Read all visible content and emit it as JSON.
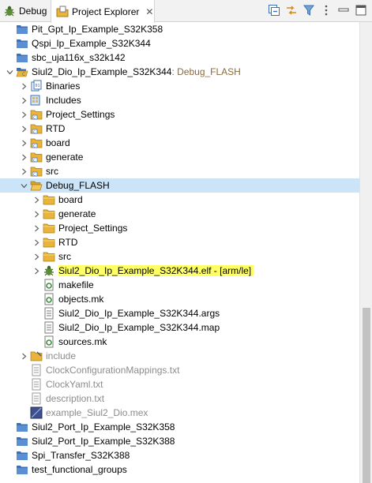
{
  "tabs": {
    "debug_label": "Debug",
    "explorer_label": "Project Explorer",
    "explorer_close": "✕"
  },
  "toolbar": {
    "icons": [
      "collapse-all-icon",
      "link-with-editor-icon",
      "filter-icon",
      "view-menu-icon",
      "minimize-icon",
      "maximize-icon"
    ]
  },
  "tree": {
    "rows": [
      {
        "label": "Pit_Gpt_Ip_Example_S32K358",
        "suffix": "",
        "icon": "project",
        "chev": "",
        "indent": 0
      },
      {
        "label": "Qspi_Ip_Example_S32K344",
        "suffix": "",
        "icon": "project",
        "chev": "",
        "indent": 0
      },
      {
        "label": "sbc_uja116x_s32k142",
        "suffix": "",
        "icon": "project",
        "chev": "",
        "indent": 0
      },
      {
        "label": "Siul2_Dio_Ip_Example_S32K344",
        "suffix": ": Debug_FLASH",
        "icon": "project-open",
        "chev": "expanded",
        "indent": 0
      },
      {
        "label": "Binaries",
        "suffix": "",
        "icon": "binaries",
        "chev": "collapsed",
        "indent": 1
      },
      {
        "label": "Includes",
        "suffix": "",
        "icon": "includes",
        "chev": "collapsed",
        "indent": 1
      },
      {
        "label": "Project_Settings",
        "suffix": "",
        "icon": "src-folder",
        "chev": "collapsed",
        "indent": 1
      },
      {
        "label": "RTD",
        "suffix": "",
        "icon": "src-folder",
        "chev": "collapsed",
        "indent": 1
      },
      {
        "label": "board",
        "suffix": "",
        "icon": "src-folder",
        "chev": "collapsed",
        "indent": 1
      },
      {
        "label": "generate",
        "suffix": "",
        "icon": "src-folder",
        "chev": "collapsed",
        "indent": 1
      },
      {
        "label": "src",
        "suffix": "",
        "icon": "src-folder",
        "chev": "collapsed",
        "indent": 1
      },
      {
        "label": "Debug_FLASH",
        "suffix": "",
        "icon": "folder-open",
        "chev": "expanded",
        "indent": 1,
        "selected": true
      },
      {
        "label": "board",
        "suffix": "",
        "icon": "folder",
        "chev": "collapsed",
        "indent": 2
      },
      {
        "label": "generate",
        "suffix": "",
        "icon": "folder",
        "chev": "collapsed",
        "indent": 2
      },
      {
        "label": "Project_Settings",
        "suffix": "",
        "icon": "folder",
        "chev": "collapsed",
        "indent": 2
      },
      {
        "label": "RTD",
        "suffix": "",
        "icon": "folder",
        "chev": "collapsed",
        "indent": 2
      },
      {
        "label": "src",
        "suffix": "",
        "icon": "folder",
        "chev": "collapsed",
        "indent": 2
      },
      {
        "label": "Siul2_Dio_Ip_Example_S32K344.elf - [arm/le]",
        "suffix": "",
        "icon": "elf",
        "chev": "collapsed",
        "indent": 2,
        "highlight": true
      },
      {
        "label": "makefile",
        "suffix": "",
        "icon": "makefile",
        "chev": "",
        "indent": 2
      },
      {
        "label": "objects.mk",
        "suffix": "",
        "icon": "mk-file",
        "chev": "",
        "indent": 2
      },
      {
        "label": "Siul2_Dio_Ip_Example_S32K344.args",
        "suffix": "",
        "icon": "text-file",
        "chev": "",
        "indent": 2
      },
      {
        "label": "Siul2_Dio_Ip_Example_S32K344.map",
        "suffix": "",
        "icon": "text-file",
        "chev": "",
        "indent": 2
      },
      {
        "label": "sources.mk",
        "suffix": "",
        "icon": "mk-file",
        "chev": "",
        "indent": 2
      },
      {
        "label": "include",
        "suffix": "",
        "icon": "folder-grey",
        "chev": "collapsed",
        "indent": 1,
        "grey": true
      },
      {
        "label": "ClockConfigurationMappings.txt",
        "suffix": "",
        "icon": "text-file-grey",
        "chev": "",
        "indent": 1,
        "grey": true
      },
      {
        "label": "ClockYaml.txt",
        "suffix": "",
        "icon": "text-file-grey",
        "chev": "",
        "indent": 1,
        "grey": true
      },
      {
        "label": "description.txt",
        "suffix": "",
        "icon": "text-file-grey",
        "chev": "",
        "indent": 1,
        "grey": true
      },
      {
        "label": "example_Siul2_Dio.mex",
        "suffix": "",
        "icon": "mex-file",
        "chev": "",
        "indent": 1,
        "grey": true
      },
      {
        "label": "Siul2_Port_Ip_Example_S32K358",
        "suffix": "",
        "icon": "project",
        "chev": "",
        "indent": 0
      },
      {
        "label": "Siul2_Port_Ip_Example_S32K388",
        "suffix": "",
        "icon": "project",
        "chev": "",
        "indent": 0
      },
      {
        "label": "Spi_Transfer_S32K388",
        "suffix": "",
        "icon": "project",
        "chev": "",
        "indent": 0
      },
      {
        "label": "test_functional_groups",
        "suffix": "",
        "icon": "project",
        "chev": "",
        "indent": 0
      }
    ]
  },
  "colors": {
    "highlight": "#ffff66",
    "selected": "#cce4f7",
    "folder": "#e8b43c",
    "project_blue": "#3d6fb3",
    "suffix": "#8b6b3b"
  }
}
